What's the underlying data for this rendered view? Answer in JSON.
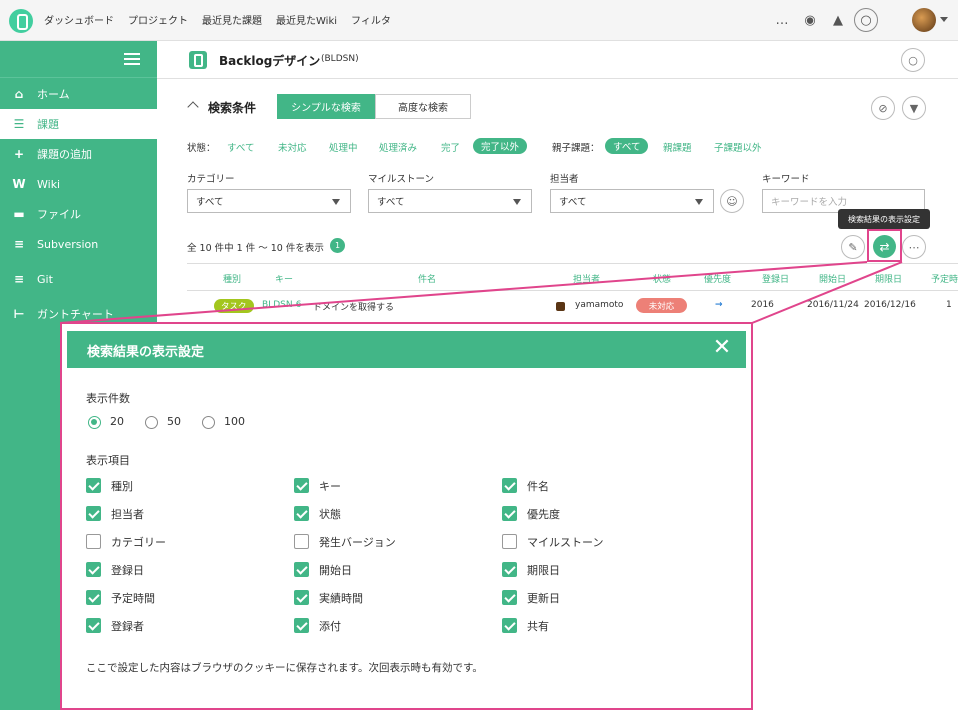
{
  "global_nav": {
    "items": [
      "ダッシュボード",
      "プロジェクト",
      "最近見た課題",
      "最近見たWiki",
      "フィルタ"
    ],
    "more": "…"
  },
  "sidebar": {
    "items": [
      {
        "label": "ホーム",
        "icon": "home-icon",
        "glyph": "⌂"
      },
      {
        "label": "課題",
        "icon": "list-icon",
        "glyph": "☰"
      },
      {
        "label": "課題の追加",
        "icon": "plus-icon",
        "glyph": "+"
      },
      {
        "label": "Wiki",
        "icon": "wiki-icon",
        "glyph": "W"
      },
      {
        "label": "ファイル",
        "icon": "file-icon",
        "glyph": "▬"
      },
      {
        "label": "Subversion",
        "icon": "svn-icon",
        "glyph": "≡"
      },
      {
        "label": "Git",
        "icon": "git-icon",
        "glyph": "≡"
      },
      {
        "label": "ガントチャート",
        "icon": "gantt-icon",
        "glyph": "⊢"
      }
    ],
    "active_index": 1
  },
  "project": {
    "name": "Backlogデザイン",
    "key": "(BLDSN)"
  },
  "search": {
    "title": "検索条件",
    "tab_simple": "シンプルな検索",
    "tab_advanced": "高度な検索",
    "status_label": "状態：",
    "status_options": [
      "すべて",
      "未対応",
      "処理中",
      "処理済み",
      "完了",
      "完了以外"
    ],
    "parent_label": "親子課題：",
    "parent_options": [
      "すべて",
      "親課題",
      "子課題以外"
    ],
    "category_label": "カテゴリー",
    "category_value": "すべて",
    "milestone_label": "マイルストーン",
    "milestone_value": "すべて",
    "assignee_label": "担当者",
    "assignee_value": "すべて",
    "keyword_label": "キーワード",
    "keyword_placeholder": "キーワードを入力"
  },
  "results": {
    "count_text": "全 10 件中 1 件 〜 10 件を表示",
    "count_badge": "1",
    "tooltip": "検索結果の表示設定"
  },
  "table": {
    "headers": [
      "種別",
      "キー",
      "件名",
      "担当者",
      "状態",
      "優先度",
      "登録日",
      "開始日",
      "期限日",
      "予定時"
    ],
    "row": {
      "type": "タスク",
      "key": "BLDSN-6",
      "subject": "ドメインを取得する",
      "assignee": "yamamoto",
      "status": "未対応",
      "priority": "→",
      "created": "2016",
      "start": "2016/11/24",
      "due": "2016/12/16",
      "estimate": "1"
    }
  },
  "modal": {
    "title": "検索結果の表示設定",
    "close": "✕",
    "count_label": "表示件数",
    "count_options": [
      "20",
      "50",
      "100"
    ],
    "count_selected": "20",
    "items_label": "表示項目",
    "items": [
      {
        "label": "種別",
        "checked": true
      },
      {
        "label": "キー",
        "checked": true
      },
      {
        "label": "件名",
        "checked": true
      },
      {
        "label": "担当者",
        "checked": true
      },
      {
        "label": "状態",
        "checked": true
      },
      {
        "label": "優先度",
        "checked": true
      },
      {
        "label": "カテゴリー",
        "checked": false
      },
      {
        "label": "発生バージョン",
        "checked": false
      },
      {
        "label": "マイルストーン",
        "checked": false
      },
      {
        "label": "登録日",
        "checked": true
      },
      {
        "label": "開始日",
        "checked": true
      },
      {
        "label": "期限日",
        "checked": true
      },
      {
        "label": "予定時間",
        "checked": true
      },
      {
        "label": "実績時間",
        "checked": true
      },
      {
        "label": "更新日",
        "checked": true
      },
      {
        "label": "登録者",
        "checked": true
      },
      {
        "label": "添付",
        "checked": true
      },
      {
        "label": "共有",
        "checked": true
      }
    ],
    "note": "ここで設定した内容はブラウザのクッキーに保存されます。次回表示時も有効です。"
  },
  "colors": {
    "brand_green": "#42b687",
    "highlight_pink": "#e0458c",
    "status_open": "#ed8077",
    "type_task": "#a3c61e"
  }
}
